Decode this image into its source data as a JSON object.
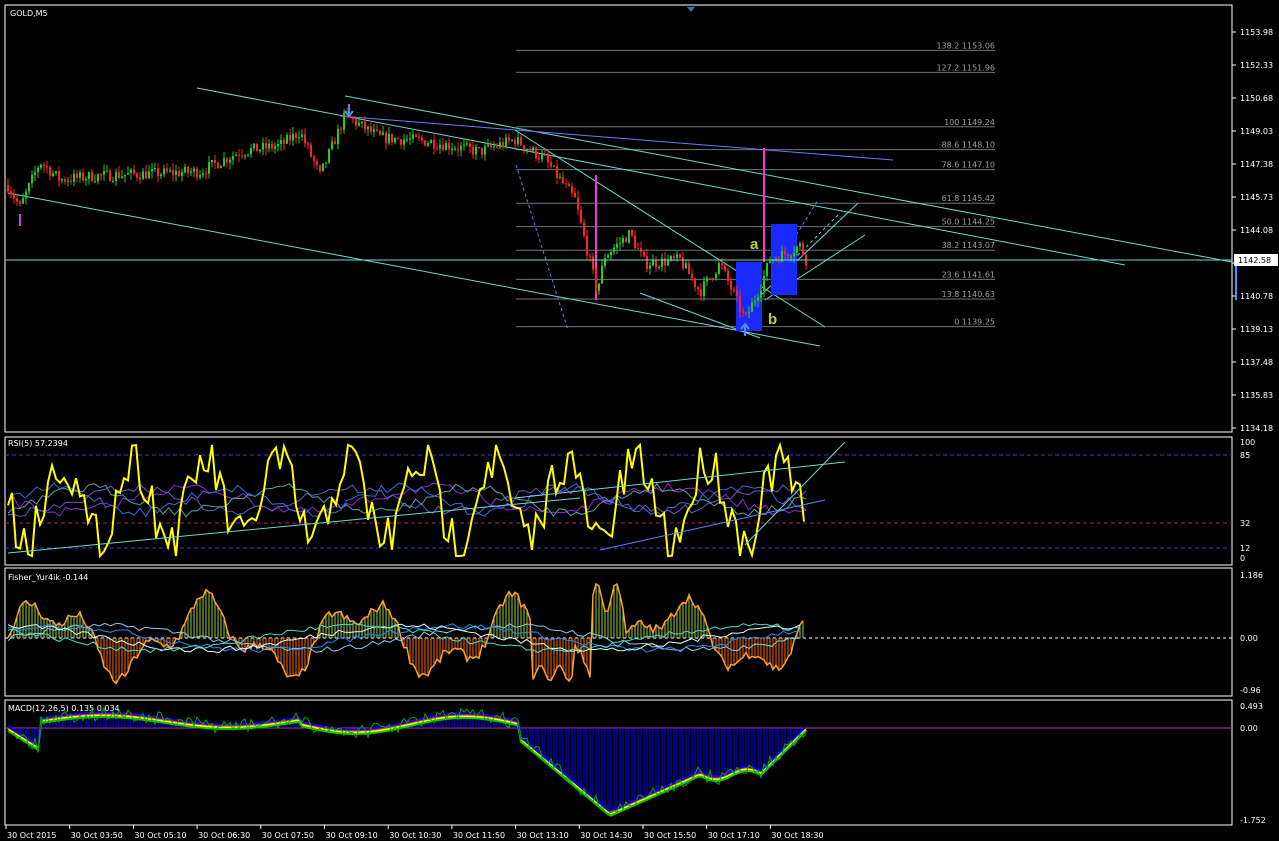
{
  "symbol_label": "GOLD,M5",
  "current_price_label": "1142.58",
  "price_axis_ticks": [
    "1153.98",
    "1152.33",
    "1150.68",
    "1149.03",
    "1147.38",
    "1145.73",
    "1144.08",
    "1142.43",
    "1140.78",
    "1139.13",
    "1137.48",
    "1135.83",
    "1134.18"
  ],
  "fibonacci_levels": [
    {
      "label": "138.2 1153.06",
      "price": 1153.06
    },
    {
      "label": "127.2 1151.96",
      "price": 1151.96
    },
    {
      "label": "100 1149.24",
      "price": 1149.24
    },
    {
      "label": "88.6 1148.10",
      "price": 1148.1
    },
    {
      "label": "78.6 1147.10",
      "price": 1147.1
    },
    {
      "label": "61.8 1145.42",
      "price": 1145.42
    },
    {
      "label": "50.0 1144.25",
      "price": 1144.25
    },
    {
      "label": "38.2 1143.07",
      "price": 1143.07
    },
    {
      "label": "23.6 1141.61",
      "price": 1141.61
    },
    {
      "label": "13.8 1140.63",
      "price": 1140.63
    },
    {
      "label": "0 1139.25",
      "price": 1139.25
    }
  ],
  "wave_labels": {
    "a": "a",
    "b": "b"
  },
  "rsi": {
    "title": "RSI(5) 57.2394",
    "ticks": [
      "100",
      "85",
      "32",
      "12",
      "0"
    ]
  },
  "fisher": {
    "title": "Fisher_Yur4ik -0.144",
    "ticks": [
      "1.186",
      "0.00",
      "-0.96"
    ]
  },
  "macd": {
    "title": "MACD(12,26,5) 0.135 0.034",
    "ticks": [
      "0.493",
      "0.00",
      "-1.752"
    ]
  },
  "time_axis": [
    "30 Oct 2015",
    "30 Oct 03:50",
    "30 Oct 05:10",
    "30 Oct 06:30",
    "30 Oct 07:50",
    "30 Oct 09:10",
    "30 Oct 10:30",
    "30 Oct 11:50",
    "30 Oct 13:10",
    "30 Oct 14:30",
    "30 Oct 15:50",
    "30 Oct 17:10",
    "30 Oct 18:30"
  ],
  "colors": {
    "background": "#000000",
    "grid": "#ffffff",
    "bull_candle": "#22cc22",
    "bear_candle": "#ff2222",
    "trend_line": "#6fd8d0",
    "channel_line": "#6b7cff",
    "rsi_line": "#ffff00",
    "fisher_bar_up": "#9acd32",
    "fisher_bar_down": "#ff6a00",
    "macd_hist": "#0000ff",
    "highlight_box": "#1a2aff",
    "magenta": "#ff33cc"
  }
}
